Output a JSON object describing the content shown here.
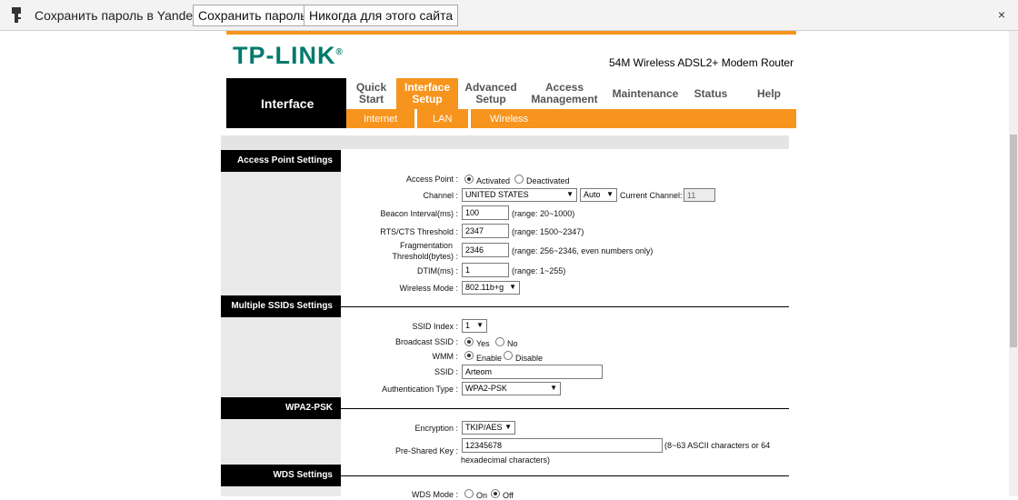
{
  "password_bar": {
    "message": "Сохранить пароль в Yandex?",
    "save_label": "Сохранить пароль",
    "never_label": "Никогда для этого сайта",
    "close_label": "×"
  },
  "header": {
    "logo": "TP-LINK",
    "logo_mark": "®",
    "model": "54M Wireless ADSL2+ Modem Router",
    "brand_color": "#007a6c",
    "accent_color": "#f7941d"
  },
  "nav": {
    "section": "Interface",
    "tabs": [
      {
        "line1": "Quick",
        "line2": "Start"
      },
      {
        "line1": "Interface",
        "line2": "Setup"
      },
      {
        "line1": "Advanced",
        "line2": "Setup"
      },
      {
        "line1": "Access",
        "line2": "Management"
      },
      {
        "line1": "Maintenance",
        "line2": ""
      },
      {
        "line1": "Status",
        "line2": ""
      },
      {
        "line1": "Help",
        "line2": ""
      }
    ],
    "subtabs": [
      "Internet",
      "LAN",
      "Wireless"
    ]
  },
  "access_point": {
    "title": "Access Point Settings",
    "access_point_label": "Access Point :",
    "activated": "Activated",
    "deactivated": "Deactivated",
    "channel_label": "Channel :",
    "country": "UNITED STATES",
    "channel_mode": "Auto",
    "current_channel_label": "Current Channel:",
    "current_channel": "11",
    "beacon_label": "Beacon Interval(ms) :",
    "beacon_value": "100",
    "beacon_range": "(range: 20~1000)",
    "rts_label": "RTS/CTS Threshold :",
    "rts_value": "2347",
    "rts_range": "(range: 1500~2347)",
    "frag_label_1": "Fragmentation",
    "frag_label_2": "Threshold(bytes) :",
    "frag_value": "2346",
    "frag_range": "(range: 256~2346, even numbers only)",
    "dtim_label": "DTIM(ms) :",
    "dtim_value": "1",
    "dtim_range": "(range: 1~255)",
    "mode_label": "Wireless Mode :",
    "mode_value": "802.11b+g"
  },
  "ssid": {
    "title": "Multiple SSIDs Settings",
    "index_label": "SSID Index :",
    "index_value": "1",
    "broadcast_label": "Broadcast SSID :",
    "yes": "Yes",
    "no": "No",
    "wmm_label": "WMM :",
    "enable": "Enable",
    "disable": "Disable",
    "ssid_label": "SSID :",
    "ssid_value": "Arteom",
    "auth_label": "Authentication Type :",
    "auth_value": "WPA2-PSK"
  },
  "wpa": {
    "title": "WPA2-PSK",
    "enc_label": "Encryption :",
    "enc_value": "TKIP/AES",
    "key_label": "Pre-Shared Key :",
    "key_value": "12345678",
    "key_hint_1": "(8~63 ASCII characters or 64",
    "key_hint_2": "hexadecimal characters)"
  },
  "wds": {
    "title": "WDS Settings",
    "mode_label": "WDS Mode :",
    "on": "On",
    "off": "Off"
  }
}
